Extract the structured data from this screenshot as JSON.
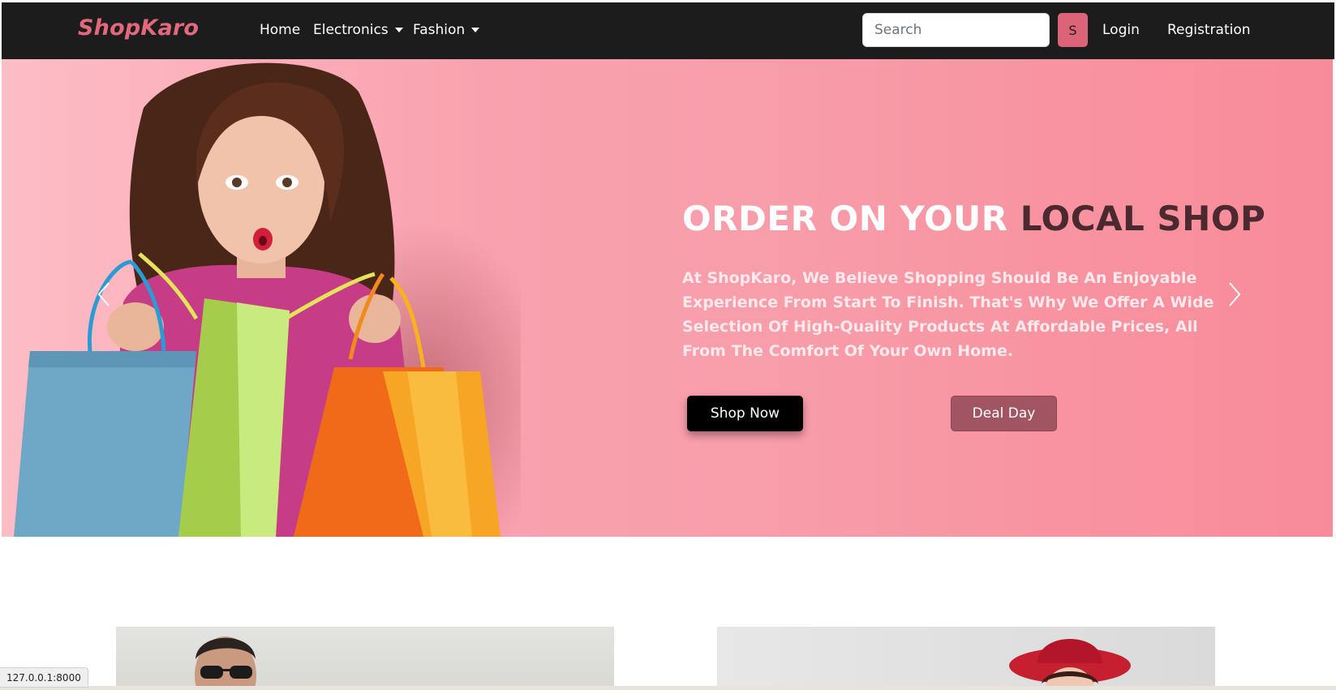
{
  "navbar": {
    "brand": "ShopKaro",
    "links": [
      {
        "label": "Home"
      },
      {
        "label": "Electronics"
      },
      {
        "label": "Fashion"
      }
    ],
    "search": {
      "placeholder": "Search",
      "value": ""
    },
    "search_button_label": "S",
    "login_label": "Login",
    "registration_label": "Registration"
  },
  "hero": {
    "title_part1": "ORDER ON YOUR",
    "title_part2": "LOCAL SHOP",
    "description": "At ShopKaro, We Believe Shopping Should Be An Enjoyable Experience From Start To Finish. That's Why We Offer A Wide Selection Of High-Quality Products At Affordable Prices, All From The Comfort Of Your Own Home.",
    "shop_now_label": "Shop Now",
    "deal_day_label": "Deal Day"
  },
  "status_bar": {
    "url": "127.0.0.1:8000"
  },
  "colors": {
    "brand": "#e2697d",
    "navbar_bg": "#1c1c1c",
    "hero_bg": "#f89eab",
    "search_button": "#dc6479",
    "deal_button": "#a15562"
  },
  "icons": {
    "carousel_prev": "chevron-left-icon",
    "carousel_next": "chevron-right-icon",
    "dropdown": "caret-down-icon"
  }
}
